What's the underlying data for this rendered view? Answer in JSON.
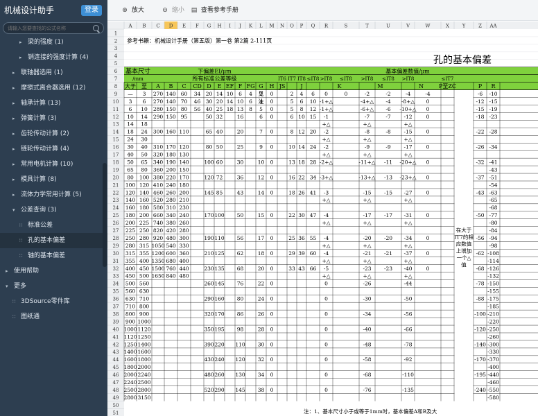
{
  "app": {
    "title": "机械设计助手",
    "login": "登录",
    "search_placeholder": "请输入您要查找的公式名称"
  },
  "sidebar": [
    {
      "label": "梁的强度 (1)",
      "level": 2,
      "arrow": "▸"
    },
    {
      "label": "销连接的强度计算 (4)",
      "level": 2,
      "arrow": "▸"
    },
    {
      "label": "联轴器选用 (1)",
      "level": 1,
      "arrow": "▸"
    },
    {
      "label": "摩擦式离合器选用 (12)",
      "level": 1,
      "arrow": "▸"
    },
    {
      "label": "轴承计算 (13)",
      "level": 1,
      "arrow": "▸"
    },
    {
      "label": "弹簧计算 (3)",
      "level": 1,
      "arrow": "▸"
    },
    {
      "label": "齿轮传动计算 (2)",
      "level": 1,
      "arrow": "▸"
    },
    {
      "label": "链轮传动计算 (4)",
      "level": 1,
      "arrow": "▸"
    },
    {
      "label": "常用电机计算 (10)",
      "level": 1,
      "arrow": "▸"
    },
    {
      "label": "模具计算 (8)",
      "level": 1,
      "arrow": "▸"
    },
    {
      "label": "流体力学常用计算 (5)",
      "level": 1,
      "arrow": "▸"
    },
    {
      "label": "公差查询 (3)",
      "level": 1,
      "arrow": "▾"
    },
    {
      "label": "标准公差",
      "level": 2,
      "arrow": "∷"
    },
    {
      "label": "孔的基本偏差",
      "level": 2,
      "arrow": "∷",
      "selected": true
    },
    {
      "label": "轴的基本偏差",
      "level": 2,
      "arrow": "∷"
    },
    {
      "label": "使用帮助",
      "level": 0,
      "arrow": "▸"
    },
    {
      "label": "更多",
      "level": 0,
      "arrow": "▾"
    },
    {
      "label": "3DSource零件库",
      "level": 1,
      "arrow": "∷"
    },
    {
      "label": "图纸通",
      "level": 1,
      "arrow": "∷"
    }
  ],
  "toolbar": {
    "zoom_in": "放大",
    "zoom_out": "缩小",
    "reference": "查看参考手册",
    "zoom_in_icon": "zoom-in-icon",
    "zoom_out_icon": "zoom-out-icon",
    "book_icon": "book-icon"
  },
  "sheet": {
    "columns": [
      "A",
      "B",
      "C",
      "D",
      "E",
      "F",
      "G",
      "H",
      "I",
      "J",
      "K",
      "L",
      "M",
      "N",
      "O",
      "P",
      "Q",
      "R",
      "S",
      "T",
      "U",
      "V",
      "W",
      "X",
      "Y",
      "Z",
      "AA"
    ],
    "selected_column": "D",
    "ref_text": "参考书籍：机械设计手册（第五版）第一卷 第2篇 2-111页",
    "title": "孔的基本偏差",
    "h_size": "基本尺寸",
    "h_mm": "/mm",
    "h_upper": "下偏差EI/μm",
    "h_all": "所有标准公差等级",
    "h_basic": "基本偏差数值/μm",
    "h_gt": "大于",
    "h_to": "至",
    "grade_row": [
      "IT6",
      "IT7",
      "IT8",
      "≤IT8",
      ">IT8",
      "≤IT8",
      ">IT8",
      "≤IT8",
      ">IT8",
      "≤IT7"
    ],
    "letters": [
      "A",
      "B",
      "C",
      "CD",
      "D",
      "E",
      "EF",
      "F",
      "FG",
      "G",
      "H",
      "JS",
      "",
      "J",
      "",
      "K",
      "M",
      "N",
      "P至ZC",
      "P",
      "R"
    ],
    "js_note": "见注",
    "note_col": "在大于IT7的相应数值上增加一个△值",
    "footnote": "注：1、基本尺寸小于或等于1mm时，基本偏差A和B及大",
    "rows": [
      [
        "—",
        "3",
        "270",
        "140",
        "60",
        "34",
        "20",
        "14",
        "10",
        "6",
        "4",
        "2",
        "0",
        "",
        "2",
        "4",
        "6",
        "0",
        "0",
        "-2",
        "-2",
        "-4",
        "-4",
        "",
        "-6",
        "-10"
      ],
      [
        "3",
        "6",
        "270",
        "140",
        "70",
        "46",
        "30",
        "20",
        "14",
        "10",
        "6",
        "4",
        "0",
        "",
        "5",
        "6",
        "10",
        "-1+△",
        "",
        "-4+△",
        "-4",
        "-8+△",
        "0",
        "",
        "-12",
        "-15"
      ],
      [
        "6",
        "10",
        "280",
        "150",
        "80",
        "56",
        "40",
        "25",
        "18",
        "13",
        "8",
        "5",
        "0",
        "",
        "5",
        "8",
        "12",
        "-1+△",
        "",
        "-6+△",
        "-6",
        "-10+△",
        "0",
        "",
        "-15",
        "-19"
      ],
      [
        "10",
        "14",
        "290",
        "150",
        "95",
        "",
        "50",
        "32",
        "",
        "16",
        "",
        "6",
        "0",
        "",
        "6",
        "10",
        "15",
        "-1\n+△",
        "",
        "-7\n+△",
        "-7",
        "-12\n+△",
        "0",
        "",
        "-18",
        "-23"
      ],
      [
        "14",
        "18",
        "",
        "",
        "",
        "",
        "",
        "",
        "",
        "",
        "",
        "",
        "",
        "",
        "",
        "",
        "",
        "",
        "",
        "",
        "",
        "",
        "",
        "",
        "",
        ""
      ],
      [
        "18",
        "24",
        "300",
        "160",
        "110",
        "",
        "65",
        "40",
        "",
        "20",
        "",
        "7",
        "0",
        "",
        "8",
        "12",
        "20",
        "-2\n+△",
        "",
        "-8\n+△",
        "-8",
        "-15\n+△",
        "0",
        "",
        "-22",
        "-28"
      ],
      [
        "24",
        "30",
        "",
        "",
        "",
        "",
        "",
        "",
        "",
        "",
        "",
        "",
        "",
        "",
        "",
        "",
        "",
        "",
        "",
        "",
        "",
        "",
        "",
        "",
        "",
        ""
      ],
      [
        "30",
        "40",
        "310",
        "170",
        "120",
        "",
        "80",
        "50",
        "",
        "25",
        "",
        "9",
        "0",
        "",
        "10",
        "14",
        "24",
        "-2\n+△",
        "",
        "-9\n+△",
        "-9",
        "-17\n+△",
        "0",
        "",
        "-26",
        "-34"
      ],
      [
        "40",
        "50",
        "320",
        "180",
        "130",
        "",
        "",
        "",
        "",
        "",
        "",
        "",
        "",
        "",
        "",
        "",
        "",
        "",
        "",
        "",
        "",
        "",
        "",
        "",
        "",
        ""
      ],
      [
        "50",
        "65",
        "340",
        "190",
        "140",
        "",
        "100",
        "60",
        "",
        "30",
        "",
        "10",
        "0",
        "",
        "13",
        "18",
        "28",
        "-2+△",
        "",
        "-11+△",
        "-11",
        "-20+△",
        "0",
        "",
        "-32",
        "-41"
      ],
      [
        "65",
        "80",
        "360",
        "200",
        "150",
        "",
        "",
        "",
        "",
        "",
        "",
        "",
        "",
        "",
        "",
        "",
        "",
        "",
        "",
        "",
        "",
        "",
        "",
        "",
        "",
        "-43"
      ],
      [
        "80",
        "100",
        "380",
        "220",
        "170",
        "",
        "120",
        "72",
        "",
        "36",
        "",
        "12",
        "0",
        "",
        "16",
        "22",
        "34",
        "-3+△",
        "",
        "-13+△",
        "-13",
        "-23+△",
        "0",
        "",
        "-37",
        "-51"
      ],
      [
        "100",
        "120",
        "410",
        "240",
        "180",
        "",
        "",
        "",
        "",
        "",
        "",
        "",
        "",
        "",
        "",
        "",
        "",
        "",
        "",
        "",
        "",
        "",
        "",
        "",
        "",
        "-54"
      ],
      [
        "120",
        "140",
        "460",
        "260",
        "200",
        "",
        "145",
        "85",
        "",
        "43",
        "",
        "14",
        "0",
        "",
        "18",
        "26",
        "41",
        "-3\n+△",
        "",
        "-15\n+△",
        "-15",
        "-27\n+△",
        "0",
        "",
        "-43",
        "-63"
      ],
      [
        "140",
        "160",
        "520",
        "280",
        "210",
        "",
        "",
        "",
        "",
        "",
        "",
        "",
        "",
        "",
        "",
        "",
        "",
        "",
        "",
        "",
        "",
        "",
        "",
        "",
        "",
        "-65"
      ],
      [
        "160",
        "180",
        "580",
        "310",
        "230",
        "",
        "",
        "",
        "",
        "",
        "",
        "",
        "",
        "",
        "",
        "",
        "",
        "",
        "",
        "",
        "",
        "",
        "",
        "",
        "",
        "-68"
      ],
      [
        "180",
        "200",
        "660",
        "340",
        "240",
        "",
        "170",
        "100",
        "",
        "50",
        "",
        "15",
        "0",
        "",
        "22",
        "30",
        "47",
        "-4\n+△",
        "",
        "-17\n+△",
        "-17",
        "-31\n+△",
        "0",
        "",
        "-50",
        "-77"
      ],
      [
        "200",
        "225",
        "740",
        "380",
        "260",
        "",
        "",
        "",
        "",
        "",
        "",
        "",
        "",
        "",
        "",
        "",
        "",
        "",
        "",
        "",
        "",
        "",
        "",
        "",
        "",
        "-80"
      ],
      [
        "225",
        "250",
        "820",
        "420",
        "280",
        "",
        "",
        "",
        "",
        "",
        "",
        "",
        "",
        "",
        "",
        "",
        "",
        "",
        "",
        "",
        "",
        "",
        "",
        "",
        "",
        "-84"
      ],
      [
        "250",
        "280",
        "920",
        "480",
        "300",
        "",
        "190",
        "110",
        "",
        "56",
        "",
        "17",
        "0",
        "",
        "25",
        "36",
        "55",
        "-4\n+△",
        "",
        "-20\n+△",
        "-20",
        "-34\n+△",
        "0",
        "",
        "-56",
        "-94"
      ],
      [
        "280",
        "315",
        "1050",
        "540",
        "330",
        "",
        "",
        "",
        "",
        "",
        "",
        "",
        "",
        "",
        "",
        "",
        "",
        "",
        "",
        "",
        "",
        "",
        "",
        "",
        "",
        "-98"
      ],
      [
        "315",
        "355",
        "1200",
        "600",
        "360",
        "",
        "210",
        "125",
        "",
        "62",
        "",
        "18",
        "0",
        "",
        "29",
        "39",
        "60",
        "-4\n+△",
        "",
        "-21\n+△",
        "-21",
        "-37\n+△",
        "0",
        "",
        "-62",
        "-108"
      ],
      [
        "355",
        "400",
        "1350",
        "680",
        "400",
        "",
        "",
        "",
        "",
        "",
        "",
        "",
        "",
        "",
        "",
        "",
        "",
        "",
        "",
        "",
        "",
        "",
        "",
        "",
        "",
        "-114"
      ],
      [
        "400",
        "450",
        "1500",
        "760",
        "440",
        "",
        "230",
        "135",
        "",
        "68",
        "",
        "20",
        "0",
        "",
        "33",
        "43",
        "66",
        "-5\n+△",
        "",
        "-23\n+△",
        "-23",
        "-40\n+△",
        "0",
        "",
        "-68",
        "-126"
      ],
      [
        "450",
        "500",
        "1650",
        "840",
        "480",
        "",
        "",
        "",
        "",
        "",
        "",
        "",
        "",
        "",
        "",
        "",
        "",
        "",
        "",
        "",
        "",
        "",
        "",
        "",
        "",
        "-132"
      ],
      [
        "500",
        "560",
        "",
        "",
        "",
        "",
        "260",
        "145",
        "",
        "76",
        "",
        "22",
        "0",
        "",
        "",
        "",
        "",
        "0",
        "",
        "-26",
        "",
        "-44",
        "",
        "",
        "-78",
        "-150"
      ],
      [
        "560",
        "630",
        "",
        "",
        "",
        "",
        "",
        "",
        "",
        "",
        "",
        "",
        "",
        "",
        "",
        "",
        "",
        "",
        "",
        "",
        "",
        "",
        "",
        "",
        "",
        "-155"
      ],
      [
        "630",
        "710",
        "",
        "",
        "",
        "",
        "290",
        "160",
        "",
        "80",
        "",
        "24",
        "0",
        "",
        "",
        "",
        "",
        "0",
        "",
        "-30",
        "",
        "-50",
        "",
        "",
        "-88",
        "-175"
      ],
      [
        "710",
        "800",
        "",
        "",
        "",
        "",
        "",
        "",
        "",
        "",
        "",
        "",
        "",
        "",
        "",
        "",
        "",
        "",
        "",
        "",
        "",
        "",
        "",
        "",
        "",
        "-185"
      ],
      [
        "800",
        "900",
        "",
        "",
        "",
        "",
        "320",
        "170",
        "",
        "86",
        "",
        "26",
        "0",
        "",
        "",
        "",
        "",
        "0",
        "",
        "-34",
        "",
        "-56",
        "",
        "",
        "-100",
        "-210"
      ],
      [
        "900",
        "1000",
        "",
        "",
        "",
        "",
        "",
        "",
        "",
        "",
        "",
        "",
        "",
        "",
        "",
        "",
        "",
        "",
        "",
        "",
        "",
        "",
        "",
        "",
        "",
        "-220"
      ],
      [
        "1000",
        "1120",
        "",
        "",
        "",
        "",
        "350",
        "195",
        "",
        "98",
        "",
        "28",
        "0",
        "",
        "",
        "",
        "",
        "0",
        "",
        "-40",
        "",
        "-66",
        "",
        "",
        "-120",
        "-250"
      ],
      [
        "1120",
        "1250",
        "",
        "",
        "",
        "",
        "",
        "",
        "",
        "",
        "",
        "",
        "",
        "",
        "",
        "",
        "",
        "",
        "",
        "",
        "",
        "",
        "",
        "",
        "",
        "-260"
      ],
      [
        "1250",
        "1400",
        "",
        "",
        "",
        "",
        "390",
        "220",
        "",
        "110",
        "",
        "30",
        "0",
        "",
        "",
        "",
        "",
        "0",
        "",
        "-48",
        "",
        "-78",
        "",
        "",
        "-140",
        "-300"
      ],
      [
        "1400",
        "1600",
        "",
        "",
        "",
        "",
        "",
        "",
        "",
        "",
        "",
        "",
        "",
        "",
        "",
        "",
        "",
        "",
        "",
        "",
        "",
        "",
        "",
        "",
        "",
        "-330"
      ],
      [
        "1600",
        "1800",
        "",
        "",
        "",
        "",
        "430",
        "240",
        "",
        "120",
        "",
        "32",
        "0",
        "",
        "",
        "",
        "",
        "0",
        "",
        "-58",
        "",
        "-92",
        "",
        "",
        "-170",
        "-370"
      ],
      [
        "1800",
        "2000",
        "",
        "",
        "",
        "",
        "",
        "",
        "",
        "",
        "",
        "",
        "",
        "",
        "",
        "",
        "",
        "",
        "",
        "",
        "",
        "",
        "",
        "",
        "",
        "-400"
      ],
      [
        "2000",
        "2240",
        "",
        "",
        "",
        "",
        "480",
        "260",
        "",
        "130",
        "",
        "34",
        "0",
        "",
        "",
        "",
        "",
        "0",
        "",
        "-68",
        "",
        "-110",
        "",
        "",
        "-195",
        "-440"
      ],
      [
        "2240",
        "2500",
        "",
        "",
        "",
        "",
        "",
        "",
        "",
        "",
        "",
        "",
        "",
        "",
        "",
        "",
        "",
        "",
        "",
        "",
        "",
        "",
        "",
        "",
        "",
        "-460"
      ],
      [
        "2500",
        "2800",
        "",
        "",
        "",
        "",
        "520",
        "290",
        "",
        "145",
        "",
        "38",
        "0",
        "",
        "",
        "",
        "",
        "0",
        "",
        "-76",
        "",
        "-135",
        "",
        "",
        "-240",
        "-550"
      ],
      [
        "2800",
        "3150",
        "",
        "",
        "",
        "",
        "",
        "",
        "",
        "",
        "",
        "",
        "",
        "",
        "",
        "",
        "",
        "",
        "",
        "",
        "",
        "",
        "",
        "",
        "",
        "-580"
      ]
    ]
  }
}
